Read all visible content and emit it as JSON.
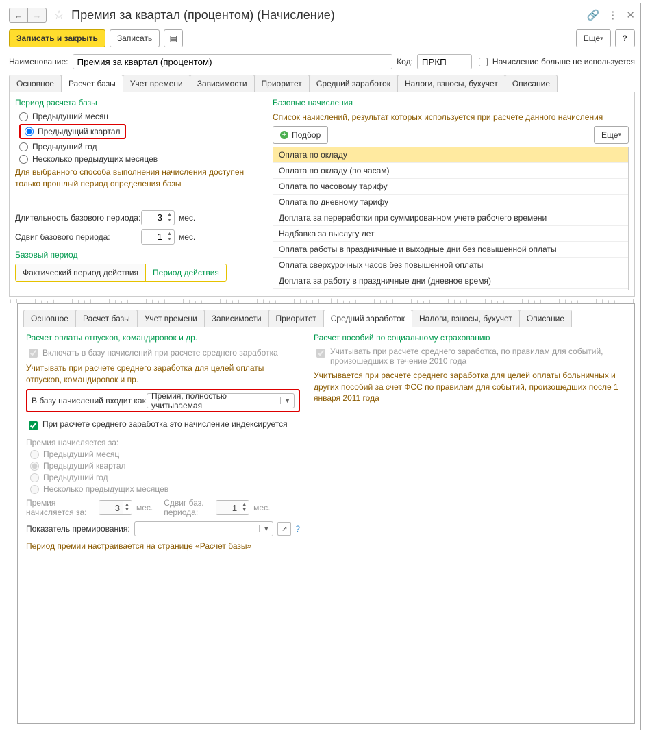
{
  "title": "Премия за квартал (процентом) (Начисление)",
  "toolbar": {
    "save_close": "Записать и закрыть",
    "save": "Записать",
    "more": "Еще",
    "help": "?"
  },
  "header_form": {
    "name_label": "Наименование:",
    "name_value": "Премия за квартал (процентом)",
    "code_label": "Код:",
    "code_value": "ПРКП",
    "not_used_label": "Начисление больше не используется"
  },
  "tabs1": [
    "Основное",
    "Расчет базы",
    "Учет времени",
    "Зависимости",
    "Приоритет",
    "Средний заработок",
    "Налоги, взносы, бухучет",
    "Описание"
  ],
  "panel1": {
    "left": {
      "section1": "Период расчета базы",
      "r1": "Предыдущий месяц",
      "r2": "Предыдущий квартал",
      "r3": "Предыдущий год",
      "r4": "Несколько предыдущих месяцев",
      "note": "Для выбранного способа выполнения начисления доступен только прошлый период определения базы",
      "base_len_label": "Длительность базового периода:",
      "base_len_val": "3",
      "shift_label": "Сдвиг базового периода:",
      "shift_val": "1",
      "mes": "мес.",
      "section2": "Базовый период",
      "seg1": "Фактический период действия",
      "seg2": "Период действия"
    },
    "right": {
      "section": "Базовые начисления",
      "desc": "Список начислений, результат которых используется при расчете данного начисления",
      "podbor": "Подбор",
      "more": "Еще",
      "rows": [
        "Оплата по окладу",
        "Оплата по окладу (по часам)",
        "Оплата по часовому тарифу",
        "Оплата по дневному тарифу",
        "Доплата за переработки при суммированном учете рабочего времени",
        "Надбавка за выслугу лет",
        "Оплата работы в праздничные и выходные дни без повышенной оплаты",
        "Оплата сверхурочных часов без повышенной оплаты",
        "Доплата за работу в праздничные дни (дневное время)"
      ]
    }
  },
  "tabs2": [
    "Основное",
    "Расчет базы",
    "Учет времени",
    "Зависимости",
    "Приоритет",
    "Средний заработок",
    "Налоги, взносы, бухучет",
    "Описание"
  ],
  "panel2": {
    "left": {
      "section": "Расчет оплаты отпусков, командировок и др.",
      "cb1": "Включать в базу начислений при расчете среднего заработка",
      "note1": "Учитывать при расчете среднего заработка для целей оплаты отпусков, командировок и пр.",
      "inbase_label": "В базу начислений входит как:",
      "inbase_value": "Премия, полностью учитываемая",
      "cb2": "При расчете среднего заработка это начисление индексируется",
      "prem_label": "Премия начисляется за:",
      "r1": "Предыдущий месяц",
      "r2": "Предыдущий квартал",
      "r3": "Предыдущий год",
      "r4": "Несколько предыдущих месяцев",
      "prem_len_label": "Премия начисляется за:",
      "prem_len_val": "3",
      "shift_label": "Сдвиг баз. периода:",
      "shift_val": "1",
      "mes": "мес.",
      "indicator_label": "Показатель премирования:",
      "help": "?",
      "footer": "Период премии настраивается на странице «Расчет базы»"
    },
    "right": {
      "section": "Расчет пособий по социальному страхованию",
      "cb1": "Учитывать при расчете среднего заработка, по правилам для событий, произошедших в течение 2010 года",
      "note1": "Учитывается при расчете среднего заработка для целей оплаты больничных и других пособий за счет ФСС по правилам для событий, произошедших после 1 января 2011 года"
    }
  }
}
